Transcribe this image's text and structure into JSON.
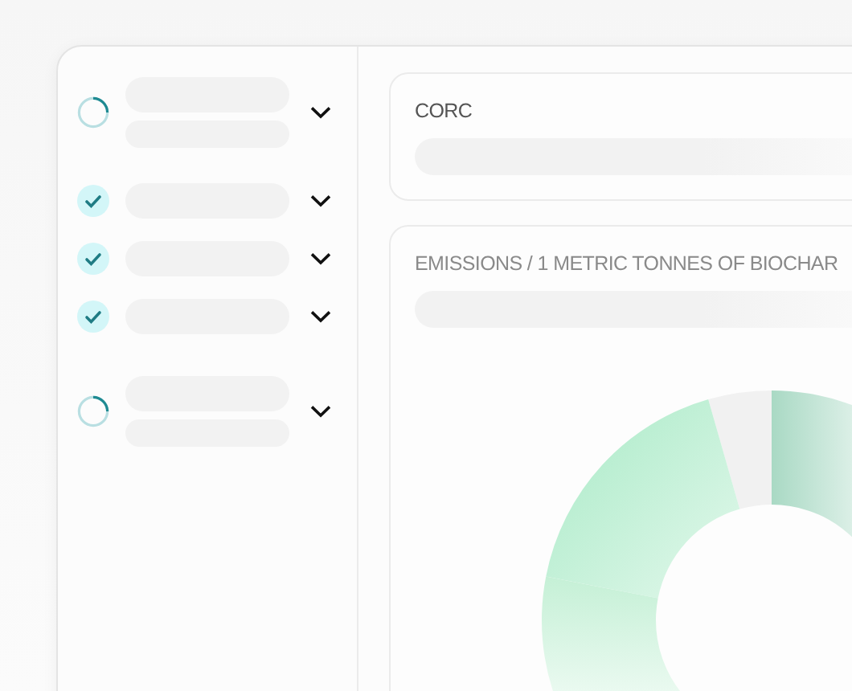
{
  "steps": [
    {
      "checked": false,
      "kind": "two-line"
    },
    {
      "checked": true,
      "kind": "one-line"
    },
    {
      "checked": true,
      "kind": "one-line"
    },
    {
      "checked": true,
      "kind": "one-line"
    },
    {
      "checked": false,
      "kind": "two-line"
    }
  ],
  "corc_card": {
    "title": "CORC"
  },
  "emissions_card": {
    "title": "EMISSIONS / 1 METRIC TONNES OF BIOCHAR"
  }
}
